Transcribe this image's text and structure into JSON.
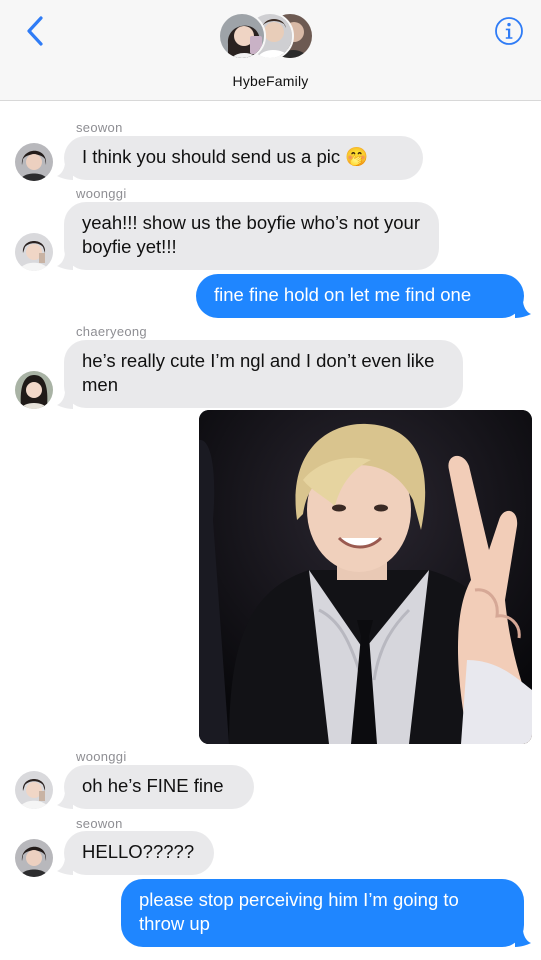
{
  "header": {
    "group_name": "HybeFamily",
    "back_icon": "chevron-left-icon",
    "info_icon": "info-circle-icon",
    "accent": "#2f7cf6"
  },
  "messages": [
    {
      "sender": "seowon",
      "text": "I think you should send us a pic 🤭",
      "direction": "incoming"
    },
    {
      "sender": "woonggi",
      "text": "yeah!!! show us the boyfie who’s not your boyfie yet!!!",
      "direction": "incoming"
    },
    {
      "sender": "",
      "text": "fine fine hold on let me find one",
      "direction": "outgoing"
    },
    {
      "sender": "chaeryeong",
      "text": "he’s really cute I’m ngl and I don’t even like men",
      "direction": "incoming"
    },
    {
      "sender": "",
      "text": "",
      "direction": "outgoing",
      "attachment": "photo"
    },
    {
      "sender": "woonggi",
      "text": "oh he’s FINE fine",
      "direction": "incoming"
    },
    {
      "sender": "seowon",
      "text": "HELLO?????",
      "direction": "incoming"
    },
    {
      "sender": "",
      "text": "please stop perceiving him I’m going to throw up",
      "direction": "outgoing"
    }
  ],
  "colors": {
    "incoming_bubble": "#e9e9eb",
    "outgoing_bubble": "#1f86ff",
    "sender_label": "#8e8e93"
  }
}
